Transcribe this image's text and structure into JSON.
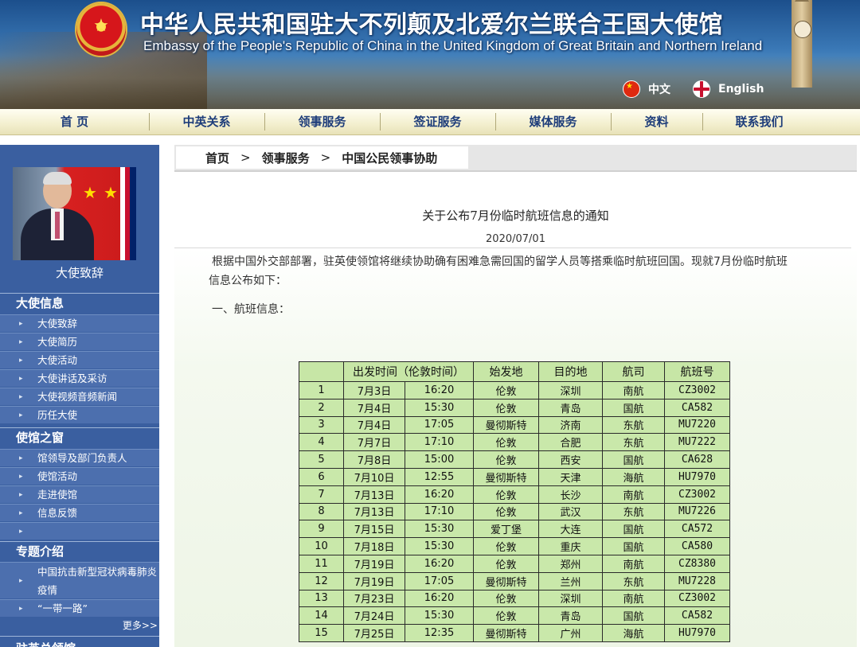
{
  "header": {
    "title_cn": "中华人民共和国驻大不列颠及北爱尔兰联合王国大使馆",
    "title_en": "Embassy of the People's Republic of China in the United Kingdom of Great Britain and Northern Ireland",
    "lang_cn": "中文",
    "lang_en": "English",
    "emblem_icon": "national-emblem-icon"
  },
  "nav": {
    "items": [
      "首 页",
      "中英关系",
      "领事服务",
      "签证服务",
      "媒体服务",
      "资料",
      "联系我们"
    ]
  },
  "sidebar": {
    "ambassador_caption": "大使致辞",
    "sections": [
      {
        "title": "大使信息",
        "items": [
          "大使致辞",
          "大使简历",
          "大使活动",
          "大使讲话及采访",
          "大使视频音频新闻",
          "历任大使"
        ]
      },
      {
        "title": "使馆之窗",
        "items": [
          "馆领导及部门负责人",
          "使馆活动",
          "走进使馆",
          "信息反馈",
          ""
        ]
      },
      {
        "title": "专题介绍",
        "items": [
          "中国抗击新型冠状病毒肺炎疫情",
          "“一带一路”"
        ]
      }
    ],
    "more": "更多>>",
    "next_section_partial": "驻英总领馆"
  },
  "breadcrumb": [
    "首页",
    "领事服务",
    "中国公民领事协助"
  ],
  "article": {
    "title": "关于公布7月份临时航班信息的通知",
    "date": "2020/07/01",
    "para1_line1": "根据中国外交部部署，驻英使领馆将继续协助确有困难急需回国的留学人员等搭乘临时航班回国。现就7月份临时航班",
    "para1_line2": "信息公布如下：",
    "section1": "一、航班信息："
  },
  "flights": {
    "headers": [
      "",
      "出发时间（伦敦时间）",
      "始发地",
      "目的地",
      "航司",
      "航班号"
    ],
    "rows": [
      [
        "1",
        "7月3日",
        "16:20",
        "伦敦",
        "深圳",
        "南航",
        "CZ3002"
      ],
      [
        "2",
        "7月4日",
        "15:30",
        "伦敦",
        "青岛",
        "国航",
        "CA582"
      ],
      [
        "3",
        "7月4日",
        "17:05",
        "曼彻斯特",
        "济南",
        "东航",
        "MU7220"
      ],
      [
        "4",
        "7月7日",
        "17:10",
        "伦敦",
        "合肥",
        "东航",
        "MU7222"
      ],
      [
        "5",
        "7月8日",
        "15:00",
        "伦敦",
        "西安",
        "国航",
        "CA628"
      ],
      [
        "6",
        "7月10日",
        "12:55",
        "曼彻斯特",
        "天津",
        "海航",
        "HU7970"
      ],
      [
        "7",
        "7月13日",
        "16:20",
        "伦敦",
        "长沙",
        "南航",
        "CZ3002"
      ],
      [
        "8",
        "7月13日",
        "17:10",
        "伦敦",
        "武汉",
        "东航",
        "MU7226"
      ],
      [
        "9",
        "7月15日",
        "15:30",
        "爱丁堡",
        "大连",
        "国航",
        "CA572"
      ],
      [
        "10",
        "7月18日",
        "15:30",
        "伦敦",
        "重庆",
        "国航",
        "CA580"
      ],
      [
        "11",
        "7月19日",
        "16:20",
        "伦敦",
        "郑州",
        "南航",
        "CZ8380"
      ],
      [
        "12",
        "7月19日",
        "17:05",
        "曼彻斯特",
        "兰州",
        "东航",
        "MU7228"
      ],
      [
        "13",
        "7月23日",
        "16:20",
        "伦敦",
        "深圳",
        "南航",
        "CZ3002"
      ],
      [
        "14",
        "7月24日",
        "15:30",
        "伦敦",
        "青岛",
        "国航",
        "CA582"
      ],
      [
        "15",
        "7月25日",
        "12:35",
        "曼彻斯特",
        "广州",
        "海航",
        "HU7970"
      ]
    ]
  },
  "colors": {
    "nav_text": "#1e3d7a",
    "sidebar_bg": "#3a5fa0",
    "table_cell": "#c9e8aa"
  }
}
